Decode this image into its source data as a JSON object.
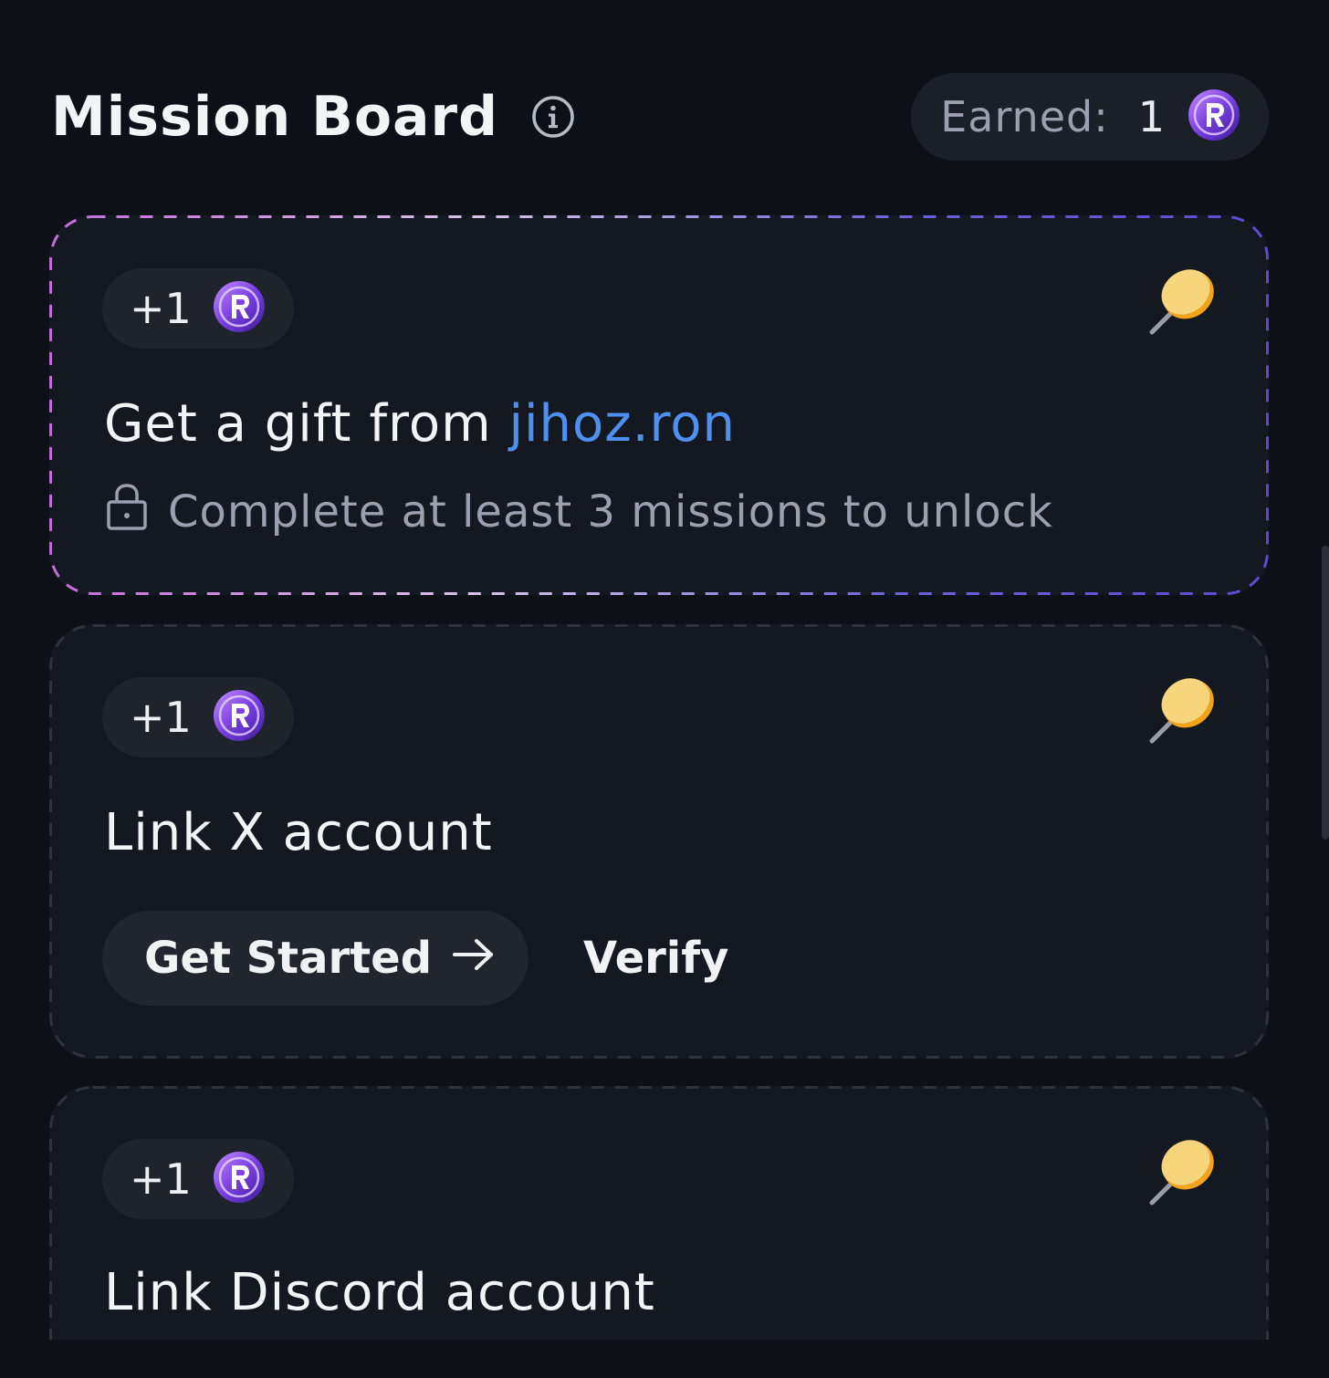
{
  "header": {
    "title": "Mission Board",
    "earned_label": "Earned:",
    "earned_value": "1"
  },
  "missions": [
    {
      "reward": "+1",
      "title_prefix": "Get a gift from ",
      "title_link": "jihoz.ron",
      "lock_text": "Complete at least 3 missions to unlock",
      "locked": true
    },
    {
      "reward": "+1",
      "title": "Link X account",
      "primary_label": "Get Started",
      "secondary_label": "Verify"
    },
    {
      "reward": "+1",
      "title": "Link Discord account"
    }
  ],
  "icons": {
    "info": "info-icon",
    "coin": "ronin-coin-icon",
    "pin": "pushpin-icon",
    "lock": "lock-icon",
    "arrow": "arrow-right-icon"
  },
  "colors": {
    "background": "#0d1016",
    "card": "#141821",
    "link": "#4f8ff0",
    "pin": "#f5c94a",
    "coin": "#8a4fe0"
  }
}
